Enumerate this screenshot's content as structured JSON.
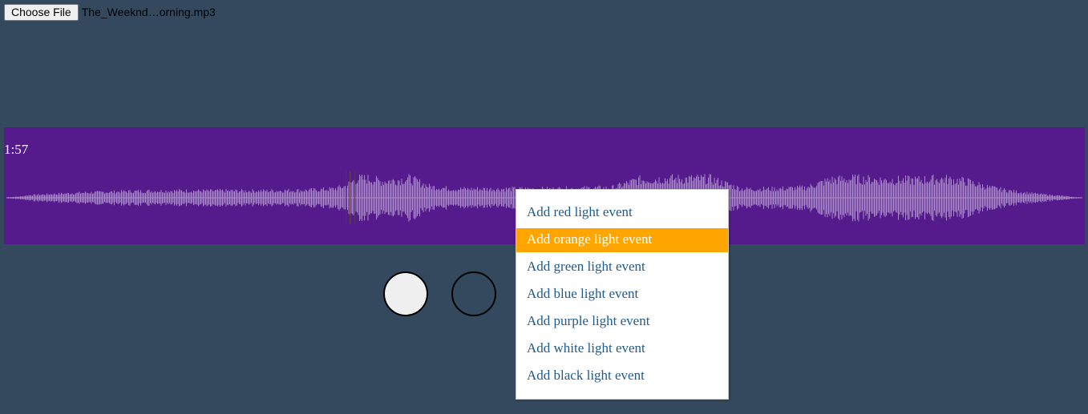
{
  "file_input": {
    "button_label": "Choose File",
    "file_name": "The_Weeknd…orning.mp3"
  },
  "player": {
    "current_time": "1:57",
    "playhead_fraction": 0.318,
    "colors": {
      "background": "#34495e",
      "waveform_panel": "#551b8c",
      "waveform": "#a98bc7"
    }
  },
  "context_menu": {
    "items": [
      {
        "label": "Add red light event"
      },
      {
        "label": "Add orange light event",
        "highlighted": true
      },
      {
        "label": "Add green light event"
      },
      {
        "label": "Add blue light event"
      },
      {
        "label": "Add purple light event"
      },
      {
        "label": "Add white light event"
      },
      {
        "label": "Add black light event"
      }
    ],
    "highlight_color": "#ffa500",
    "text_color": "#205a8c"
  },
  "light_circles": [
    {
      "state": "on",
      "color": "#efefef"
    },
    {
      "state": "off",
      "color": "#34495e"
    }
  ]
}
